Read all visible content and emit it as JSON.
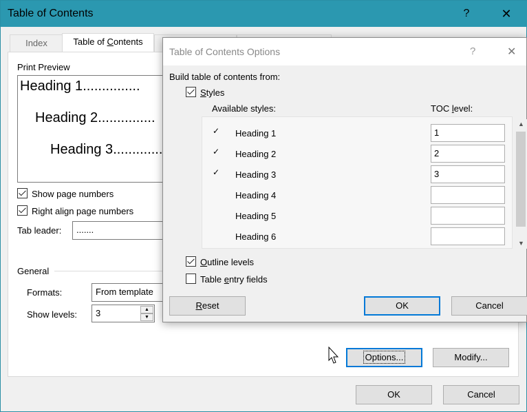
{
  "outer": {
    "title": "Table of Contents",
    "help": "?",
    "close": "✕",
    "tabs": [
      "Index",
      "Table of Contents"
    ],
    "print_preview_label": "Print Preview",
    "preview": [
      "Heading 1",
      "Heading 2",
      "Heading 3"
    ],
    "preview_leader": "...............",
    "show_page_numbers": "Show page numbers",
    "right_align": "Right align page numbers",
    "tab_leader_label": "Tab leader:",
    "tab_leader_value": ".......",
    "general_label": "General",
    "formats_label": "Formats:",
    "formats_value": "From template",
    "show_levels_label": "Show levels:",
    "show_levels_value": "3",
    "options_button": "Options...",
    "modify_button": "Modify...",
    "ok_button": "OK",
    "cancel_button": "Cancel"
  },
  "inner": {
    "title": "Table of Contents Options",
    "help": "?",
    "close": "✕",
    "build_label": "Build table of contents from:",
    "styles_label": "Styles",
    "available_styles_label": "Available styles:",
    "toc_level_label": "TOC level:",
    "styles": [
      {
        "name": "Heading 1",
        "level": "1",
        "checked": "✓"
      },
      {
        "name": "Heading 2",
        "level": "2",
        "checked": "✓"
      },
      {
        "name": "Heading 3",
        "level": "3",
        "checked": "✓"
      },
      {
        "name": "Heading 4",
        "level": "",
        "checked": ""
      },
      {
        "name": "Heading 5",
        "level": "",
        "checked": ""
      },
      {
        "name": "Heading 6",
        "level": "",
        "checked": ""
      }
    ],
    "outline_levels": "Outline levels",
    "table_entry_fields": "Table entry fields",
    "reset_button": "Reset",
    "ok_button": "OK",
    "cancel_button": "Cancel"
  }
}
